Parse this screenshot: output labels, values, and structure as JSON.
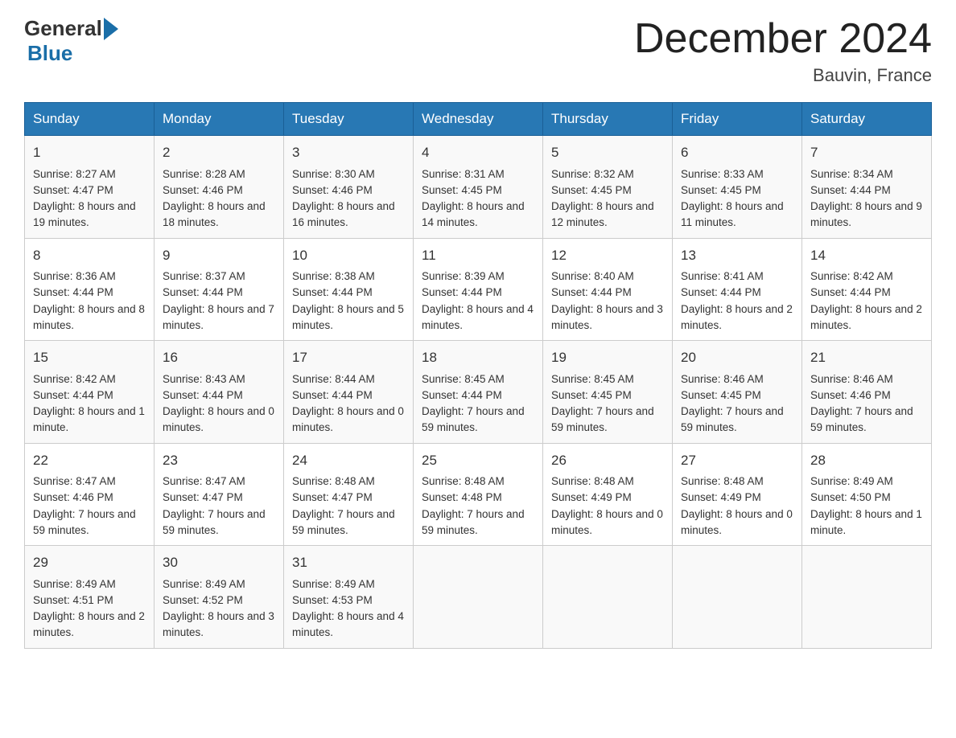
{
  "header": {
    "logo_general": "General",
    "logo_blue": "Blue",
    "month_title": "December 2024",
    "location": "Bauvin, France"
  },
  "days_of_week": [
    "Sunday",
    "Monday",
    "Tuesday",
    "Wednesday",
    "Thursday",
    "Friday",
    "Saturday"
  ],
  "weeks": [
    [
      {
        "day": "1",
        "sunrise": "Sunrise: 8:27 AM",
        "sunset": "Sunset: 4:47 PM",
        "daylight": "Daylight: 8 hours and 19 minutes."
      },
      {
        "day": "2",
        "sunrise": "Sunrise: 8:28 AM",
        "sunset": "Sunset: 4:46 PM",
        "daylight": "Daylight: 8 hours and 18 minutes."
      },
      {
        "day": "3",
        "sunrise": "Sunrise: 8:30 AM",
        "sunset": "Sunset: 4:46 PM",
        "daylight": "Daylight: 8 hours and 16 minutes."
      },
      {
        "day": "4",
        "sunrise": "Sunrise: 8:31 AM",
        "sunset": "Sunset: 4:45 PM",
        "daylight": "Daylight: 8 hours and 14 minutes."
      },
      {
        "day": "5",
        "sunrise": "Sunrise: 8:32 AM",
        "sunset": "Sunset: 4:45 PM",
        "daylight": "Daylight: 8 hours and 12 minutes."
      },
      {
        "day": "6",
        "sunrise": "Sunrise: 8:33 AM",
        "sunset": "Sunset: 4:45 PM",
        "daylight": "Daylight: 8 hours and 11 minutes."
      },
      {
        "day": "7",
        "sunrise": "Sunrise: 8:34 AM",
        "sunset": "Sunset: 4:44 PM",
        "daylight": "Daylight: 8 hours and 9 minutes."
      }
    ],
    [
      {
        "day": "8",
        "sunrise": "Sunrise: 8:36 AM",
        "sunset": "Sunset: 4:44 PM",
        "daylight": "Daylight: 8 hours and 8 minutes."
      },
      {
        "day": "9",
        "sunrise": "Sunrise: 8:37 AM",
        "sunset": "Sunset: 4:44 PM",
        "daylight": "Daylight: 8 hours and 7 minutes."
      },
      {
        "day": "10",
        "sunrise": "Sunrise: 8:38 AM",
        "sunset": "Sunset: 4:44 PM",
        "daylight": "Daylight: 8 hours and 5 minutes."
      },
      {
        "day": "11",
        "sunrise": "Sunrise: 8:39 AM",
        "sunset": "Sunset: 4:44 PM",
        "daylight": "Daylight: 8 hours and 4 minutes."
      },
      {
        "day": "12",
        "sunrise": "Sunrise: 8:40 AM",
        "sunset": "Sunset: 4:44 PM",
        "daylight": "Daylight: 8 hours and 3 minutes."
      },
      {
        "day": "13",
        "sunrise": "Sunrise: 8:41 AM",
        "sunset": "Sunset: 4:44 PM",
        "daylight": "Daylight: 8 hours and 2 minutes."
      },
      {
        "day": "14",
        "sunrise": "Sunrise: 8:42 AM",
        "sunset": "Sunset: 4:44 PM",
        "daylight": "Daylight: 8 hours and 2 minutes."
      }
    ],
    [
      {
        "day": "15",
        "sunrise": "Sunrise: 8:42 AM",
        "sunset": "Sunset: 4:44 PM",
        "daylight": "Daylight: 8 hours and 1 minute."
      },
      {
        "day": "16",
        "sunrise": "Sunrise: 8:43 AM",
        "sunset": "Sunset: 4:44 PM",
        "daylight": "Daylight: 8 hours and 0 minutes."
      },
      {
        "day": "17",
        "sunrise": "Sunrise: 8:44 AM",
        "sunset": "Sunset: 4:44 PM",
        "daylight": "Daylight: 8 hours and 0 minutes."
      },
      {
        "day": "18",
        "sunrise": "Sunrise: 8:45 AM",
        "sunset": "Sunset: 4:44 PM",
        "daylight": "Daylight: 7 hours and 59 minutes."
      },
      {
        "day": "19",
        "sunrise": "Sunrise: 8:45 AM",
        "sunset": "Sunset: 4:45 PM",
        "daylight": "Daylight: 7 hours and 59 minutes."
      },
      {
        "day": "20",
        "sunrise": "Sunrise: 8:46 AM",
        "sunset": "Sunset: 4:45 PM",
        "daylight": "Daylight: 7 hours and 59 minutes."
      },
      {
        "day": "21",
        "sunrise": "Sunrise: 8:46 AM",
        "sunset": "Sunset: 4:46 PM",
        "daylight": "Daylight: 7 hours and 59 minutes."
      }
    ],
    [
      {
        "day": "22",
        "sunrise": "Sunrise: 8:47 AM",
        "sunset": "Sunset: 4:46 PM",
        "daylight": "Daylight: 7 hours and 59 minutes."
      },
      {
        "day": "23",
        "sunrise": "Sunrise: 8:47 AM",
        "sunset": "Sunset: 4:47 PM",
        "daylight": "Daylight: 7 hours and 59 minutes."
      },
      {
        "day": "24",
        "sunrise": "Sunrise: 8:48 AM",
        "sunset": "Sunset: 4:47 PM",
        "daylight": "Daylight: 7 hours and 59 minutes."
      },
      {
        "day": "25",
        "sunrise": "Sunrise: 8:48 AM",
        "sunset": "Sunset: 4:48 PM",
        "daylight": "Daylight: 7 hours and 59 minutes."
      },
      {
        "day": "26",
        "sunrise": "Sunrise: 8:48 AM",
        "sunset": "Sunset: 4:49 PM",
        "daylight": "Daylight: 8 hours and 0 minutes."
      },
      {
        "day": "27",
        "sunrise": "Sunrise: 8:48 AM",
        "sunset": "Sunset: 4:49 PM",
        "daylight": "Daylight: 8 hours and 0 minutes."
      },
      {
        "day": "28",
        "sunrise": "Sunrise: 8:49 AM",
        "sunset": "Sunset: 4:50 PM",
        "daylight": "Daylight: 8 hours and 1 minute."
      }
    ],
    [
      {
        "day": "29",
        "sunrise": "Sunrise: 8:49 AM",
        "sunset": "Sunset: 4:51 PM",
        "daylight": "Daylight: 8 hours and 2 minutes."
      },
      {
        "day": "30",
        "sunrise": "Sunrise: 8:49 AM",
        "sunset": "Sunset: 4:52 PM",
        "daylight": "Daylight: 8 hours and 3 minutes."
      },
      {
        "day": "31",
        "sunrise": "Sunrise: 8:49 AM",
        "sunset": "Sunset: 4:53 PM",
        "daylight": "Daylight: 8 hours and 4 minutes."
      },
      null,
      null,
      null,
      null
    ]
  ]
}
